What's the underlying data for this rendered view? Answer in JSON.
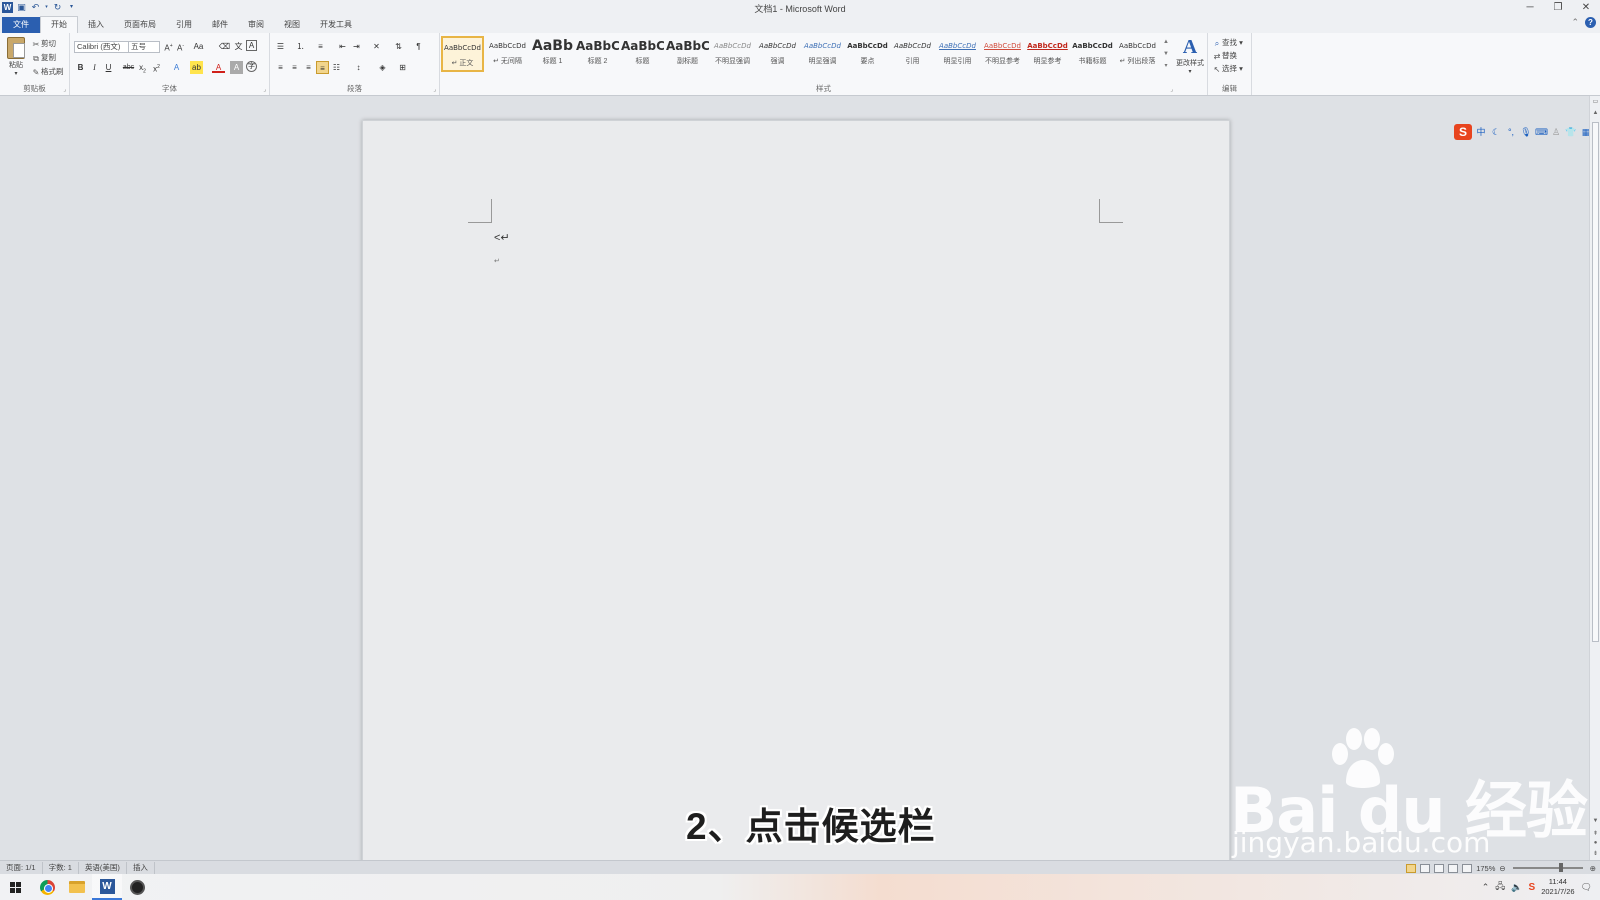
{
  "window": {
    "title": "文档1 - Microsoft Word",
    "controls": [
      "─",
      "❐",
      "✕"
    ]
  },
  "tabs": [
    {
      "label": "文件",
      "kind": "file"
    },
    {
      "label": "开始",
      "kind": "active"
    },
    {
      "label": "插入"
    },
    {
      "label": "页面布局"
    },
    {
      "label": "引用"
    },
    {
      "label": "邮件"
    },
    {
      "label": "审阅"
    },
    {
      "label": "视图"
    },
    {
      "label": "开发工具"
    }
  ],
  "ribbon": {
    "clipboard": {
      "group_label": "剪贴板",
      "paste_label": "粘贴",
      "cut_label": "剪切",
      "copy_label": "复制",
      "format_painter_label": "格式刷"
    },
    "font": {
      "group_label": "字体",
      "font_name": "Calibri (西文)",
      "font_size": "五号"
    },
    "paragraph": {
      "group_label": "段落"
    },
    "styles": {
      "group_label": "样式",
      "change_styles_label": "更改样式",
      "items": [
        {
          "sample": "AaBbCcDd",
          "name": "↵ 正文",
          "selected": true
        },
        {
          "sample": "AaBbCcDd",
          "name": "↵ 无间隔"
        },
        {
          "sample": "AaBb",
          "name": "标题 1"
        },
        {
          "sample": "AaBbC",
          "name": "标题 2"
        },
        {
          "sample": "AaBbC",
          "name": "标题"
        },
        {
          "sample": "AaBbC",
          "name": "副标题"
        },
        {
          "sample": "AaBbCcDd",
          "name": "不明显强调"
        },
        {
          "sample": "AaBbCcDd",
          "name": "强调"
        },
        {
          "sample": "AaBbCcDd",
          "name": "明显强调"
        },
        {
          "sample": "AaBbCcDd",
          "name": "要点"
        },
        {
          "sample": "AaBbCcDd",
          "name": "引用"
        },
        {
          "sample": "AaBbCcDd",
          "name": "明显引用"
        },
        {
          "sample": "AaBbCcDd",
          "name": "不明显参考"
        },
        {
          "sample": "AaBbCcDd",
          "name": "明显参考"
        },
        {
          "sample": "AaBbCcDd",
          "name": "书籍标题"
        },
        {
          "sample": "AaBbCcDd",
          "name": "↵ 列出段落"
        }
      ]
    },
    "editing": {
      "group_label": "编辑",
      "find_label": "查找",
      "replace_label": "替换",
      "select_label": "选择"
    }
  },
  "document": {
    "typed_text": "<↵",
    "paragraph_mark": "↵"
  },
  "ime": {
    "logo": "S",
    "mode": "中"
  },
  "overlay": {
    "caption": "2、点击候选栏",
    "watermark_brand": "Bai du 经验",
    "watermark_url": "jingyan.baidu.com"
  },
  "statusbar": {
    "page": "页面: 1/1",
    "words": "字数: 1",
    "language": "英语(美国)",
    "mode": "插入",
    "zoom": "175%"
  },
  "taskbar": {
    "time": "11:44",
    "date": "2021/7/26"
  },
  "colors": {
    "file_tab": "#2b5fb0",
    "selected_style_border": "#e8b545",
    "caption_text": "#1e1e1e",
    "ime_logo": "#e8441e"
  }
}
